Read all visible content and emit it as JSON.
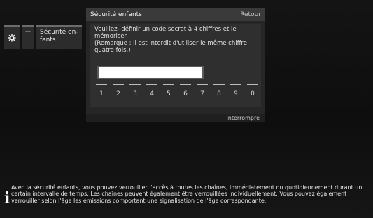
{
  "sidebar": {
    "gear_icon": "gear-icon",
    "dots_label": "···",
    "item_label": "Sécurité en-\nfants"
  },
  "dialog": {
    "title": "Sécurité enfants",
    "back_label": "Retour",
    "message_line1": "Veuillez- définir un code secret à 4 chiffres et le",
    "message_line2": "mémoriser.",
    "message_line3": "(Remarque : il est interdit d'utiliser le même chiffre",
    "message_line4": "quatre fois.)",
    "code_value": "",
    "keypad": [
      "1",
      "2",
      "3",
      "4",
      "5",
      "6",
      "7",
      "8",
      "9",
      "0"
    ],
    "cancel_label": "Interrompre"
  },
  "info": {
    "icon": "info-icon",
    "text": "Avec la sécurité enfants, vous pouvez verrouiller l'accès à toutes les chaînes, immédiatement ou quotidiennement durant un certain intervalle de temps. Les chaînes peuvent également être verrouillées individuellement. Vous pouvez également verrouiller selon l'âge les émissions comportant une signalisation de l'âge correspondante."
  },
  "colors": {
    "background": "#0b0b0b",
    "dialog_header": "#3a3a3a",
    "dialog_body": "#262626",
    "field_fill": "#ffffff"
  }
}
